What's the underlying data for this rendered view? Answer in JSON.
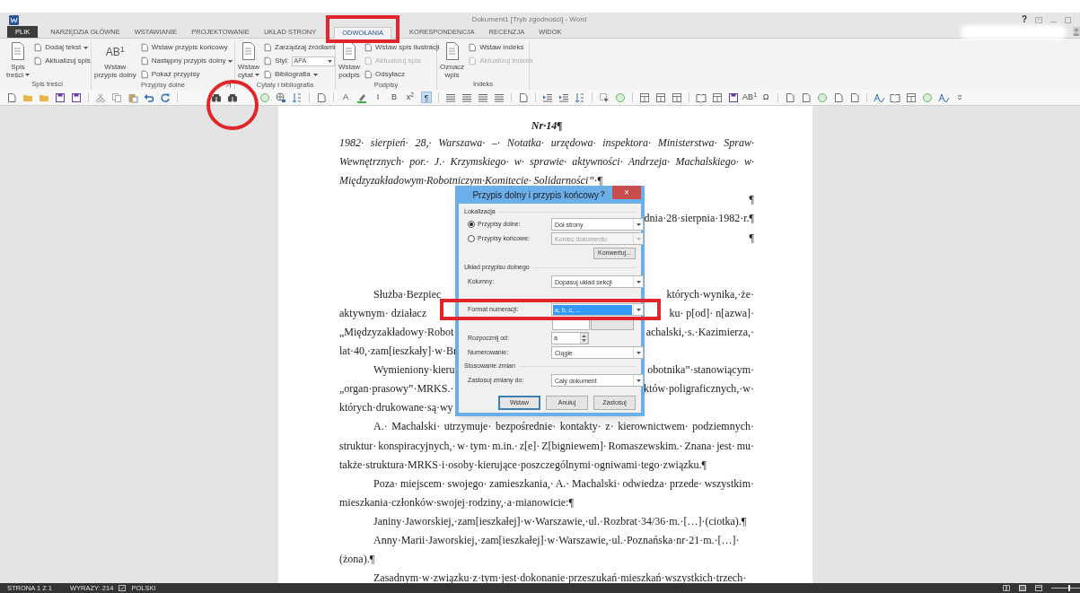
{
  "title_bar": {
    "title": "Dokument1 [Tryb zgodności] - Word",
    "help": "?"
  },
  "tabs": [
    {
      "label": "PLIK",
      "kind": "file",
      "selected": false
    },
    {
      "label": "NARZĘDZIA GŁÓWNE",
      "kind": "tab",
      "selected": false
    },
    {
      "label": "WSTAWIANIE",
      "kind": "tab",
      "selected": false
    },
    {
      "label": "PROJEKTOWANIE",
      "kind": "tab",
      "selected": false
    },
    {
      "label": "UKŁAD STRONY",
      "kind": "tab",
      "selected": false
    },
    {
      "label": "ODWOŁANIA",
      "kind": "tab",
      "selected": true
    },
    {
      "label": "KORESPONDENCJA",
      "kind": "tab",
      "selected": false
    },
    {
      "label": "RECENZJA",
      "kind": "tab",
      "selected": false
    },
    {
      "label": "WIDOK",
      "kind": "tab",
      "selected": false
    }
  ],
  "ribbon_groups": [
    {
      "label": "Spis treści",
      "items": [
        {
          "kind": "big",
          "lines": [
            "Spis",
            "treści"
          ],
          "dropdown": true
        },
        {
          "kind": "stack",
          "rows": [
            {
              "kind": "button",
              "label": "Dodaj tekst",
              "dropdown": true,
              "disabled": false
            },
            {
              "kind": "button",
              "label": "Aktualizuj spis",
              "dropdown": false,
              "disabled": false
            }
          ]
        }
      ]
    },
    {
      "label": "Przypisy dolne",
      "launcher": true,
      "items": [
        {
          "kind": "big",
          "glyph": "AB$^{1}$",
          "lines": [
            "Wstaw",
            "przypis dolny"
          ],
          "dropdown": false
        },
        {
          "kind": "stack",
          "rows": [
            {
              "kind": "button",
              "label": "Wstaw przypis końcowy",
              "dropdown": false,
              "disabled": false
            },
            {
              "kind": "button",
              "label": "Następny przypis dolny",
              "dropdown": true,
              "disabled": false
            },
            {
              "kind": "button",
              "label": "Pokaż przypisy",
              "dropdown": false,
              "disabled": false
            }
          ]
        }
      ]
    },
    {
      "label": "Cytaty i bibliografia",
      "items": [
        {
          "kind": "big",
          "lines": [
            "Wstaw",
            "cytat"
          ],
          "dropdown": true
        },
        {
          "kind": "stack",
          "rows": [
            {
              "kind": "button",
              "label": "Zarządzaj źródłami",
              "dropdown": false,
              "disabled": false
            },
            {
              "kind": "combo",
              "label": "Styl:",
              "value": "APA",
              "dropdown": true,
              "disabled": false
            },
            {
              "kind": "button",
              "label": "Bibliografia",
              "dropdown": true,
              "disabled": false
            }
          ]
        }
      ]
    },
    {
      "label": "Podpisy",
      "items": [
        {
          "kind": "big",
          "lines": [
            "Wstaw",
            "podpis"
          ],
          "dropdown": false
        },
        {
          "kind": "stack",
          "rows": [
            {
              "kind": "button",
              "label": "Wstaw spis ilustracji",
              "dropdown": false,
              "disabled": false
            },
            {
              "kind": "button",
              "label": "Aktualizuj spis",
              "dropdown": false,
              "disabled": true
            },
            {
              "kind": "button",
              "label": "Odsyłacz",
              "dropdown": false,
              "disabled": false
            }
          ]
        }
      ]
    },
    {
      "label": "Indeks",
      "items": [
        {
          "kind": "big",
          "lines": [
            "Oznacz",
            "wpis"
          ],
          "dropdown": false
        },
        {
          "kind": "stack",
          "rows": [
            {
              "kind": "button",
              "label": "Wstaw indeks",
              "dropdown": false,
              "disabled": false
            },
            {
              "kind": "button",
              "label": "Aktualizuj indeks",
              "dropdown": false,
              "disabled": true
            }
          ]
        }
      ]
    }
  ],
  "toolbar": [
    {
      "text": "A",
      "pressed": false
    },
    {
      "text": "I",
      "pressed": false
    },
    {
      "text": "B",
      "pressed": false
    },
    {
      "text": "x$^{2}$",
      "pressed": false
    },
    {
      "text": "¶",
      "pressed": true
    },
    {
      "text": "AB$^{1}$",
      "pressed": false
    },
    {
      "text": "Ω",
      "pressed": false
    }
  ],
  "document": {
    "heading": "Nr·14¶",
    "lines": [
      {
        "kind": "justified",
        "italic": true,
        "indent": false,
        "text": "1982· sierpień· 28,· Warszawa· –· Notatka· urzędowa· inspektora· Ministerstwa· Spraw·"
      },
      {
        "kind": "justified",
        "italic": true,
        "indent": false,
        "text": "Wewnętrznych· por.· J.· Krzymskiego· w· sprawie· aktywności· Andrzeja· Machalskiego· w·"
      },
      {
        "kind": "plain",
        "italic": true,
        "indent": false,
        "text": "Międzyzakładowym·Robotniczym·Komitecie· Solidarności”·¶"
      },
      {
        "kind": "right",
        "italic": false,
        "text": "¶"
      },
      {
        "kind": "right",
        "italic": false,
        "text": "dnia·28·sierpnia·1982·r.¶"
      },
      {
        "kind": "right",
        "italic": false,
        "text": "¶"
      },
      {
        "kind": "blank"
      },
      {
        "kind": "blank"
      },
      {
        "kind": "split",
        "italic": false,
        "indent": true,
        "left": "Służba·Bezpiec",
        "right": "których·wynika,·że·"
      },
      {
        "kind": "split",
        "italic": false,
        "indent": false,
        "left": "aktywnym· działacz",
        "right": "ku· p[od]· n[azwa]·"
      },
      {
        "kind": "split",
        "italic": false,
        "indent": false,
        "left": "„Międzyzakładowy·Robot",
        "right": "achalski,·s.·Kazimierza,·"
      },
      {
        "kind": "split",
        "italic": false,
        "indent": false,
        "left": "lat·40,·zam[ieszkały]·w·Br"
      },
      {
        "kind": "split",
        "italic": false,
        "indent": true,
        "left": "Wymieniony·kieru",
        "right": "obotnika”·stanowiącym·"
      },
      {
        "kind": "split",
        "italic": false,
        "indent": false,
        "left": "„organ·prasowy”·MRKS.·",
        "right": "któw·poligraficznych,·w·"
      },
      {
        "kind": "split",
        "italic": false,
        "indent": false,
        "left": "których·drukowane·są·wy"
      },
      {
        "kind": "justified",
        "italic": false,
        "indent": true,
        "text": "A.· Machalski· utrzymuje· bezpośrednie· kontakty· z· kierownictwem· podziemnych·"
      },
      {
        "kind": "justified",
        "italic": false,
        "indent": false,
        "text": "struktur· konspiracyjnych,· w· tym· m.in.· z[e]· Z[bigniewem]· Romaszewskim.· Znana· jest· mu·"
      },
      {
        "kind": "plain",
        "italic": false,
        "indent": false,
        "text": "także·struktura·MRKS·i·osoby·kierujące·poszczególnymi·ogniwami·tego·związku.¶"
      },
      {
        "kind": "justified",
        "italic": false,
        "indent": true,
        "text": "Poza· miejscem· swojego· zamieszkania,· A.· Machalski· odwiedza· przede· wszystkim·"
      },
      {
        "kind": "plain",
        "italic": false,
        "indent": false,
        "text": "mieszkania·członków·swojej·rodziny,·a·mianowicie:¶"
      },
      {
        "kind": "plain",
        "italic": false,
        "indent": true,
        "text": "Janiny·Jaworskiej,·zam[ieszkałej]·w·Warszawie,·ul.·Rozbrat·34/36·m.·[…]·(ciotka).¶"
      },
      {
        "kind": "justified",
        "italic": false,
        "indent": true,
        "text": "Anny·Marii·Jaworskiej,·zam[ieszkałej]·w·Warszawie,·ul.·Poznańska·nr·21·m.·[…]·"
      },
      {
        "kind": "plain",
        "italic": false,
        "indent": false,
        "text": "(żona).¶"
      },
      {
        "kind": "justified",
        "italic": false,
        "indent": true,
        "text": "Zasadnym·w·związku·z·tym·jest·dokonanie·przeszukań·mieszkań·wszystkich·trzech·"
      }
    ]
  },
  "dialog": {
    "title": "Przypis dolny i przypis końcowy",
    "help": "?",
    "close": "×",
    "location": {
      "heading": "Lokalizacja",
      "options": [
        {
          "label": "Przypisy dolne:",
          "selected": true,
          "value": "Dół strony",
          "disabled": false
        },
        {
          "label": "Przypisy końcowe:",
          "selected": false,
          "value": "Koniec dokumentu",
          "disabled": true
        }
      ],
      "convert_button": "Konwertuj..."
    },
    "layout": {
      "heading": "Układ przypisu dolnego",
      "label": "Kolumny:",
      "value": "Dopasuj układ sekcji"
    },
    "format_fields": [
      {
        "kind": "select",
        "label": "Format numeracji:",
        "value": "a, b, c, ...",
        "highlighted": true
      },
      {
        "kind": "covered"
      },
      {
        "kind": "spinner",
        "label": "Rozpocznij od:",
        "value": "a",
        "highlighted": false
      },
      {
        "kind": "select",
        "label": "Numerowanie:",
        "value": "Ciągłe",
        "highlighted": false
      }
    ],
    "apply": {
      "heading": "Stosowanie zmian",
      "label": "Zastosuj zmiany do:",
      "value": "Cały dokument"
    },
    "buttons": [
      {
        "label": "Wstaw",
        "default": true
      },
      {
        "label": "Anuluj",
        "default": false
      },
      {
        "label": "Zastosuj",
        "default": false
      }
    ]
  },
  "status_bar": {
    "page": "STRONA 1 Z 1",
    "words": "WYRAZY: 214",
    "language": "POLSKI",
    "zoom": {
      "level": 0.55
    }
  }
}
